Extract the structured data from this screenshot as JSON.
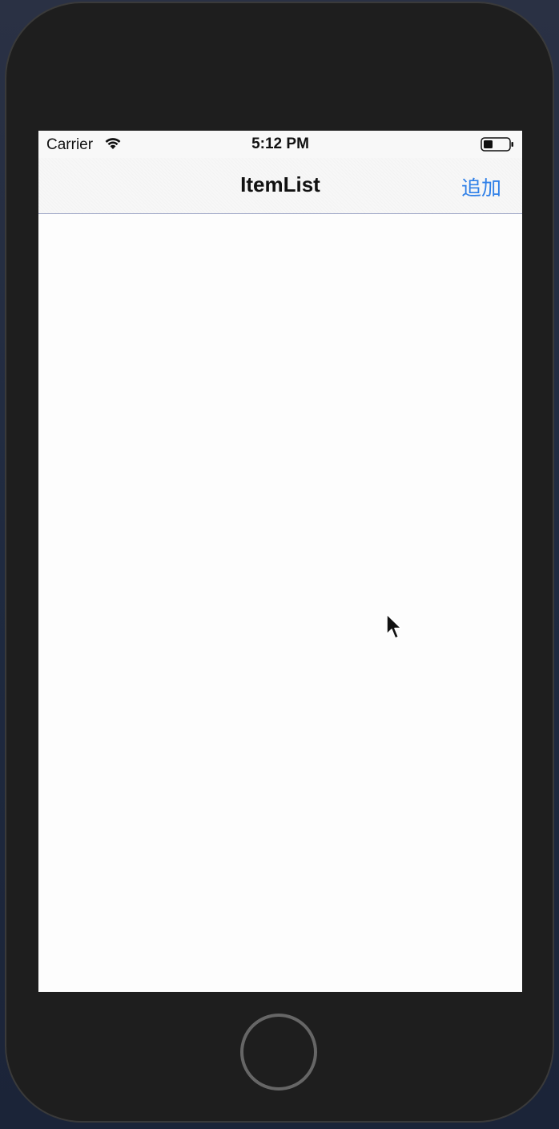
{
  "status_bar": {
    "carrier": "Carrier",
    "time": "5:12 PM",
    "wifi_icon": "wifi-icon",
    "battery_icon": "battery-icon"
  },
  "nav_bar": {
    "title": "ItemList",
    "add_label": "追加"
  },
  "colors": {
    "accent": "#2f80e8",
    "device_frame": "#1e1e1e",
    "screen_bg": "#fdfdfd"
  },
  "icons": {
    "cursor": "cursor-icon",
    "home": "home-button"
  }
}
